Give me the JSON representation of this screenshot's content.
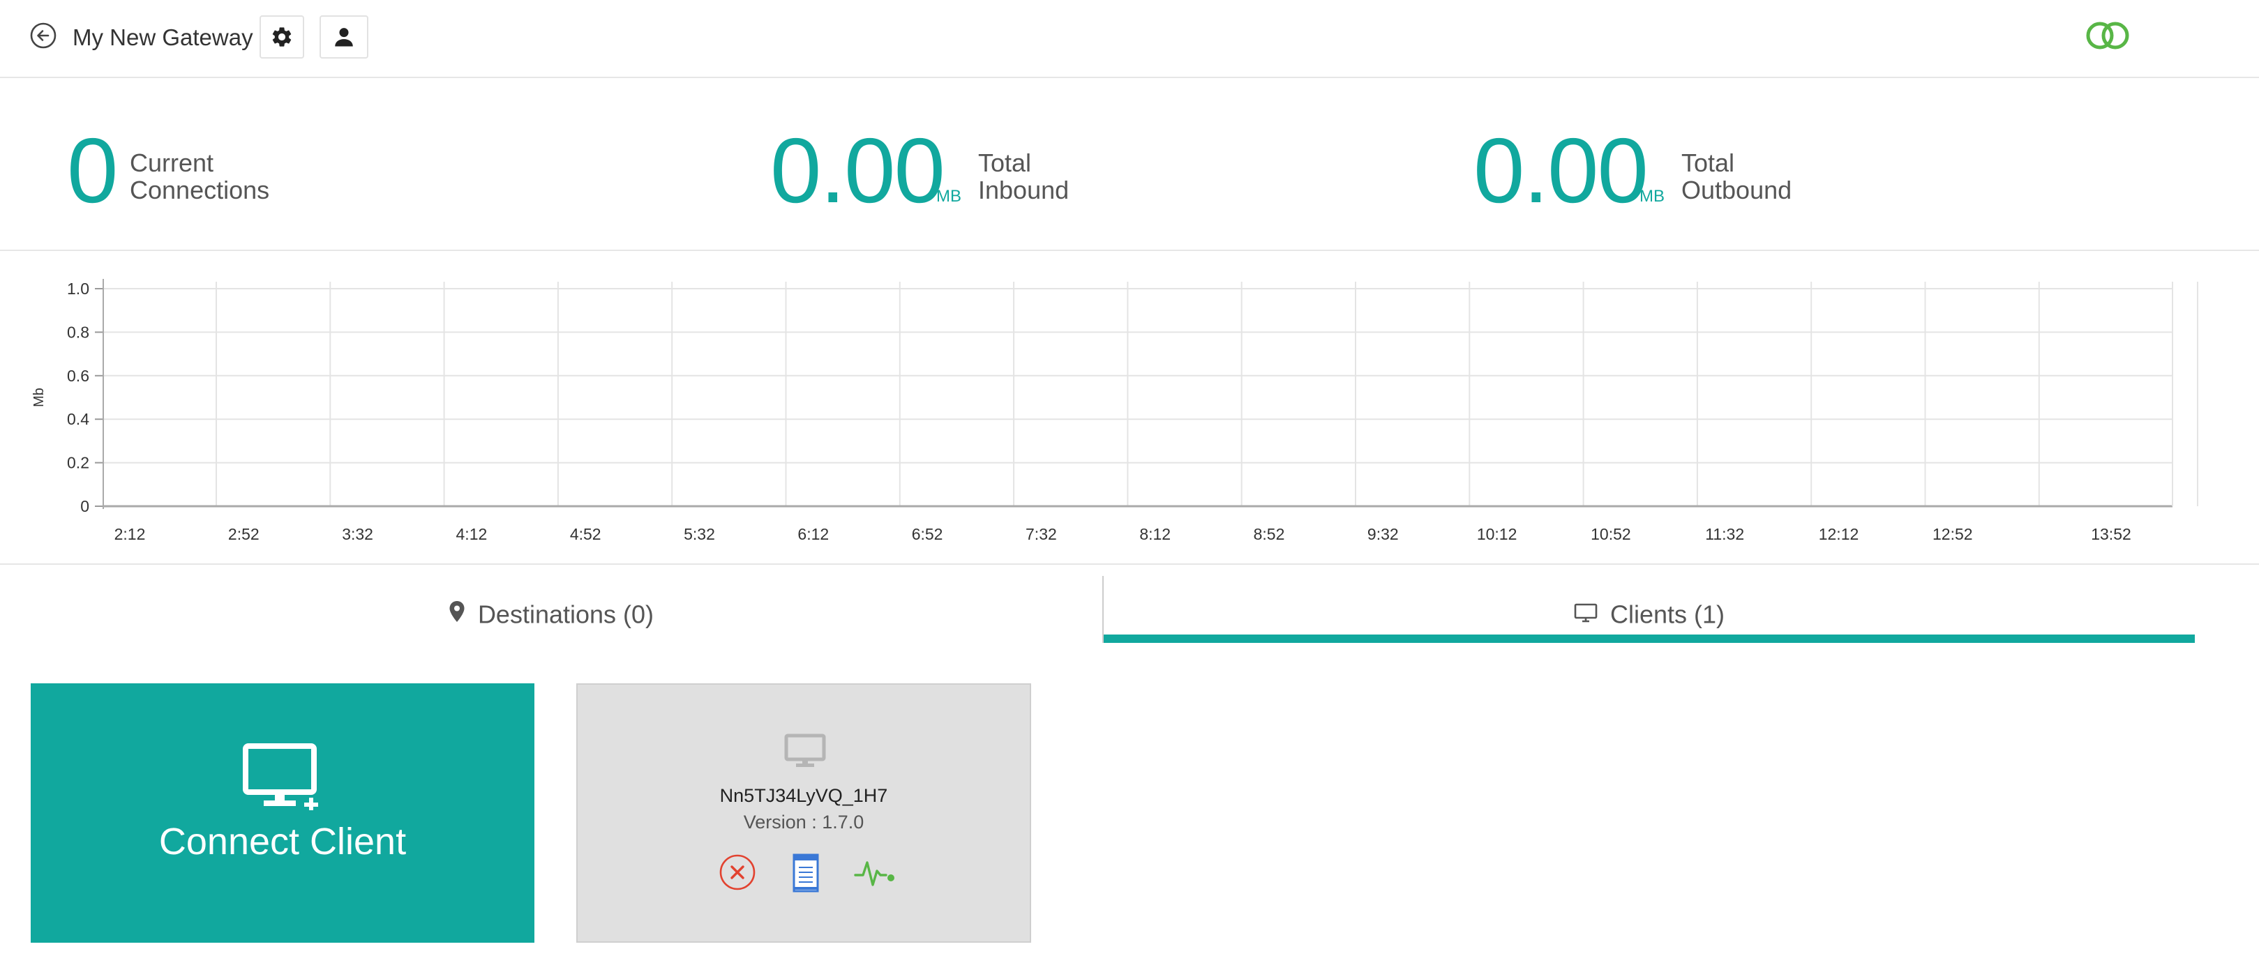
{
  "header": {
    "gateway_name": "My New Gateway",
    "icons": {
      "back": "back-arrow-icon",
      "settings": "gear-icon",
      "user": "user-icon",
      "logo": "linked-rings-logo-icon"
    },
    "logo_color": "#58b646"
  },
  "stats": {
    "connections": {
      "value": "0",
      "unit": "",
      "label_line1": "Current",
      "label_line2": "Connections"
    },
    "inbound": {
      "value": "0.00",
      "unit": "MB",
      "label_line1": "Total",
      "label_line2": "Inbound"
    },
    "outbound": {
      "value": "0.00",
      "unit": "MB",
      "label_line1": "Total",
      "label_line2": "Outbound"
    },
    "accent_color": "#11a89e"
  },
  "chart_data": {
    "type": "line",
    "title": "",
    "xlabel": "",
    "ylabel": "Mb",
    "ylim": [
      0,
      1.0
    ],
    "y_ticks": [
      "1.0",
      "0.8",
      "0.6",
      "0.4",
      "0.2",
      "0"
    ],
    "x_ticks": [
      "2:12",
      "2:52",
      "3:32",
      "4:12",
      "4:52",
      "5:32",
      "6:12",
      "6:52",
      "7:32",
      "8:12",
      "8:52",
      "9:32",
      "10:12",
      "10:52",
      "11:32",
      "12:12",
      "12:52",
      "13:52"
    ],
    "series": [],
    "grid": true
  },
  "tabs": {
    "destinations": {
      "label": "Destinations (0)",
      "icon": "map-pin-icon"
    },
    "clients": {
      "label": "Clients (1)",
      "icon": "monitor-icon",
      "active": true
    }
  },
  "connect_card": {
    "label": "Connect Client",
    "icon": "monitor-add-icon"
  },
  "client": {
    "name": "Nn5TJ34LyVQ_1H7",
    "version": "Version : 1.7.0",
    "actions": [
      {
        "icon": "remove-circle-icon",
        "color": "#e2422f"
      },
      {
        "icon": "log-document-icon",
        "color": "#3a78d6"
      },
      {
        "icon": "pulse-monitor-icon",
        "color": "#58b646"
      }
    ]
  }
}
